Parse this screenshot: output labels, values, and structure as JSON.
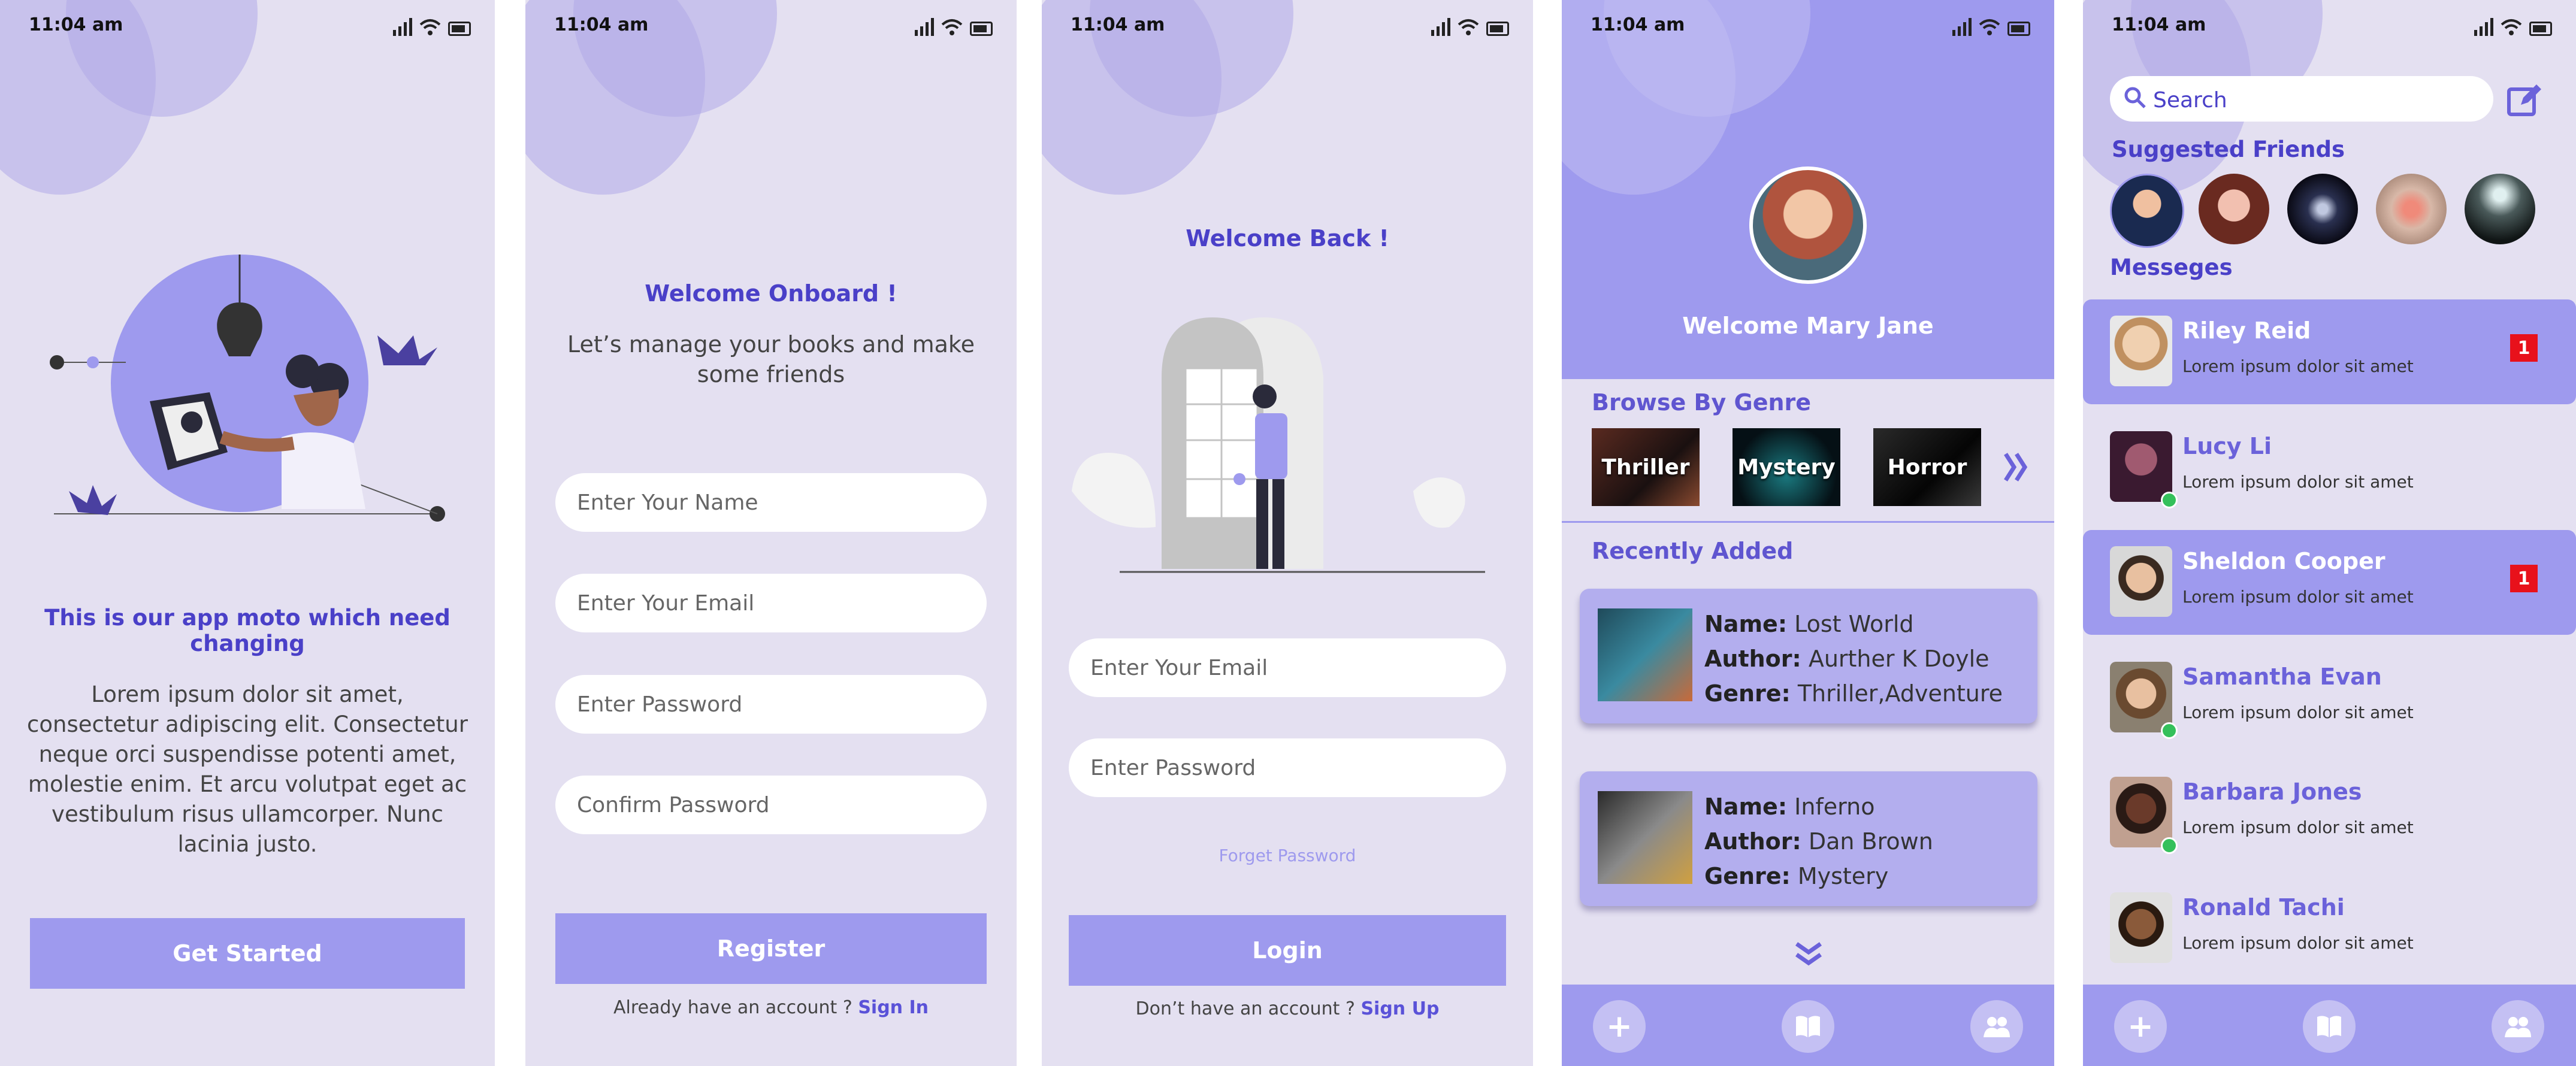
{
  "status": {
    "time": "11:04 am"
  },
  "screen1": {
    "headline": "This is our app moto which need changing",
    "body": "Lorem ipsum dolor sit amet, consectetur adipiscing elit. Consectetur neque orci suspendisse potenti amet, molestie enim. Et arcu volutpat eget ac vestibulum risus ullamcorper. Nunc lacinia justo.",
    "cta": "Get Started"
  },
  "screen2": {
    "title": "Welcome Onboard !",
    "subtitle": "Let’s manage your books and make some friends",
    "fields": {
      "name_placeholder": "Enter Your Name",
      "email_placeholder": "Enter Your Email",
      "password_placeholder": "Enter Password",
      "confirm_placeholder": "Confirm Password"
    },
    "button": "Register",
    "footer_text": "Already have an account ?",
    "footer_link": "Sign In"
  },
  "screen3": {
    "title": "Welcome Back !",
    "fields": {
      "email_placeholder": "Enter Your Email",
      "password_placeholder": "Enter Password"
    },
    "forgot": "Forget Password",
    "button": "Login",
    "footer_text": "Don’t have an account ?",
    "footer_link": "Sign Up"
  },
  "screen4": {
    "welcome": "Welcome Mary Jane",
    "browse_title": "Browse By Genre",
    "genres": [
      "Thriller",
      "Mystery",
      "Horror"
    ],
    "recent_title": "Recently Added",
    "labels": {
      "name": "Name:",
      "author": "Author:",
      "genre": "Genre:"
    },
    "books": [
      {
        "name": "Lost World",
        "author": "Aurther K Doyle",
        "genre": "Thriller,Adventure"
      },
      {
        "name": "Inferno",
        "author": "Dan Brown",
        "genre": "Mystery"
      }
    ],
    "nav_icons": [
      "plus-icon",
      "book-icon",
      "friends-icon"
    ]
  },
  "screen5": {
    "search_placeholder": "Search",
    "suggested_title": "Suggested Friends",
    "messages_title": "Messeges",
    "messages": [
      {
        "name": "Riley Reid",
        "text": "Lorem ipsum dolor sit amet",
        "unread": "1",
        "active": true
      },
      {
        "name": "Lucy Li",
        "text": "Lorem ipsum dolor sit amet",
        "online": true
      },
      {
        "name": "Sheldon Cooper",
        "text": "Lorem ipsum dolor sit amet",
        "unread": "1",
        "active": true
      },
      {
        "name": "Samantha Evan",
        "text": "Lorem ipsum dolor sit amet",
        "online": true
      },
      {
        "name": "Barbara Jones",
        "text": "Lorem ipsum dolor sit amet",
        "online": true
      },
      {
        "name": "Ronald Tachi",
        "text": "Lorem ipsum dolor sit amet"
      }
    ]
  },
  "colors": {
    "accent": "#9e9aee",
    "background": "#e4e0f1",
    "title": "#4a40c8",
    "badge": "#e8111b"
  }
}
